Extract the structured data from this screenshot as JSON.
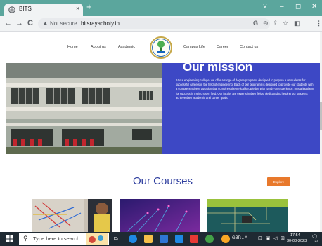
{
  "browser": {
    "tab_title": "BITS",
    "tab_close": "×",
    "new_tab": "+",
    "window_controls": {
      "chevron": "˅",
      "minimize": "–",
      "maximize": "◻",
      "close": "✕"
    },
    "nav": {
      "back": "←",
      "forward": "→",
      "reload": "C"
    },
    "security_label": "Not secure",
    "url": "bitsrayachoty.in",
    "toolbar_icons": [
      "google-g-icon",
      "zoom-icon",
      "share-icon",
      "bookmark-star-icon",
      "sidebar-icon",
      "profile-icon",
      "menu-icon"
    ],
    "toolbar_glyphs": {
      "google": "G",
      "zoom": "⊖",
      "share": "⇪",
      "star": "☆",
      "sidebar": "◧",
      "menu": "⋮"
    }
  },
  "site": {
    "nav_left": [
      "Home",
      "About us",
      "Academic"
    ],
    "nav_right": [
      "Campus Life",
      "Career",
      "Contact us"
    ],
    "mission_title": "Our mission",
    "mission_text": "At our engineering college, we offer a range of degree programs designed to prepare a ur students for successful careers in the field of engineering. Each of our programs is designed to provide our students with a comprehensive e ducation that combines theoretical knowledge with hands-on experience, preparing them for success in their chosen field. Our faculty are experts in their fields, dedicated to helping our students achieve their academic and career goals.",
    "courses_title": "Our Courses",
    "explore_label": "Explore"
  },
  "taskbar": {
    "search_placeholder": "Type here to search",
    "tray_text": "GBP... ^",
    "time": "17:54",
    "date": "30-08-2023",
    "notification_count": "22"
  },
  "colors": {
    "tabstrip": "#5ba69d",
    "mission_bg": "#3d48c5",
    "courses_title": "#2d3d9e",
    "explore_btn": "#e8792c",
    "taskbar": "#1f2a33"
  }
}
